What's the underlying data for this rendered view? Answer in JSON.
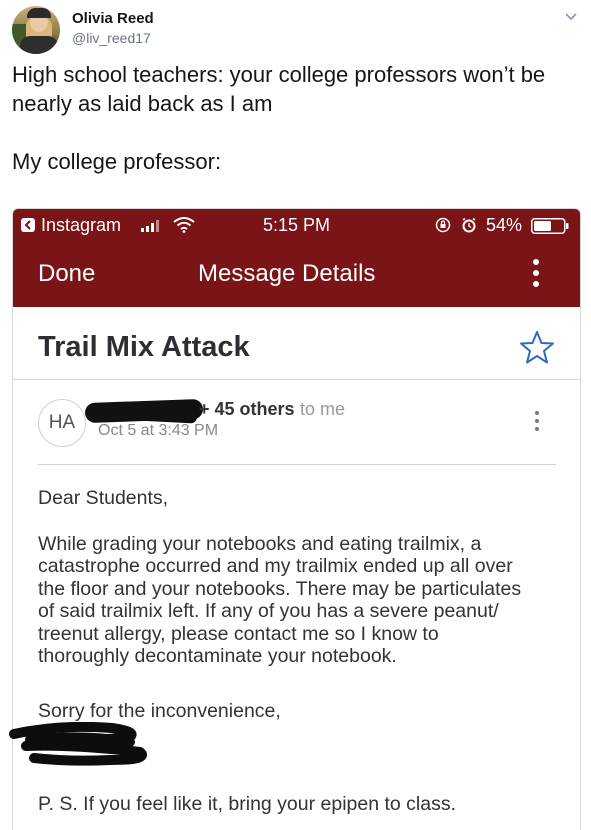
{
  "tweet": {
    "author_name": "Olivia Reed",
    "author_handle": "@liv_reed17",
    "text_line1": "High school teachers: your college professors won’t be",
    "text_line2": "nearly as laid back as I am",
    "text_line3": "My college professor:"
  },
  "phone_status": {
    "app": "Instagram",
    "time": "5:15 PM",
    "battery": "54%"
  },
  "navbar": {
    "done_label": "Done",
    "title": "Message Details"
  },
  "email": {
    "subject": "Trail Mix Attack",
    "sender_initials": "HA",
    "recipients_others": "+ 45 others",
    "recipients_to": "to me",
    "date": "Oct 5 at 3:43 PM",
    "greeting": "Dear Students,",
    "body_lines": [
      "While grading your notebooks and eating trailmix, a",
      "catastrophe occurred and my trailmix ended up all over",
      "the floor and your notebooks. There may be particulates",
      "of said trailmix left. If any of you has a severe peanut/",
      "treenut allergy, please contact me so I know  to",
      "thoroughly decontaminate your notebook."
    ],
    "signoff": "Sorry for the inconvenience,",
    "postscript": "P. S. If you feel like it, bring your epipen to class."
  },
  "colors": {
    "header_red": "#7b1417",
    "twitter_gray": "#657786"
  },
  "icons": [
    "chevron-down-icon",
    "back-arrow-icon",
    "signal-icon",
    "wifi-icon",
    "rotation-lock-icon",
    "alarm-icon",
    "battery-icon",
    "more-vertical-icon",
    "star-icon"
  ]
}
